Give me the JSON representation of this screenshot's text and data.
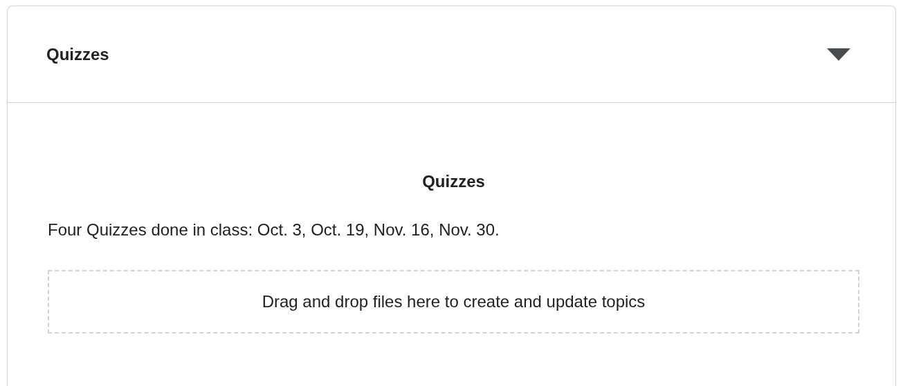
{
  "section": {
    "title": "Quizzes",
    "expanded": true
  },
  "content": {
    "heading": "Quizzes",
    "text": "Four Quizzes done in class: Oct. 3, Oct. 19, Nov. 16, Nov. 30.",
    "dropzone": "Drag and drop files here to create and update topics"
  }
}
